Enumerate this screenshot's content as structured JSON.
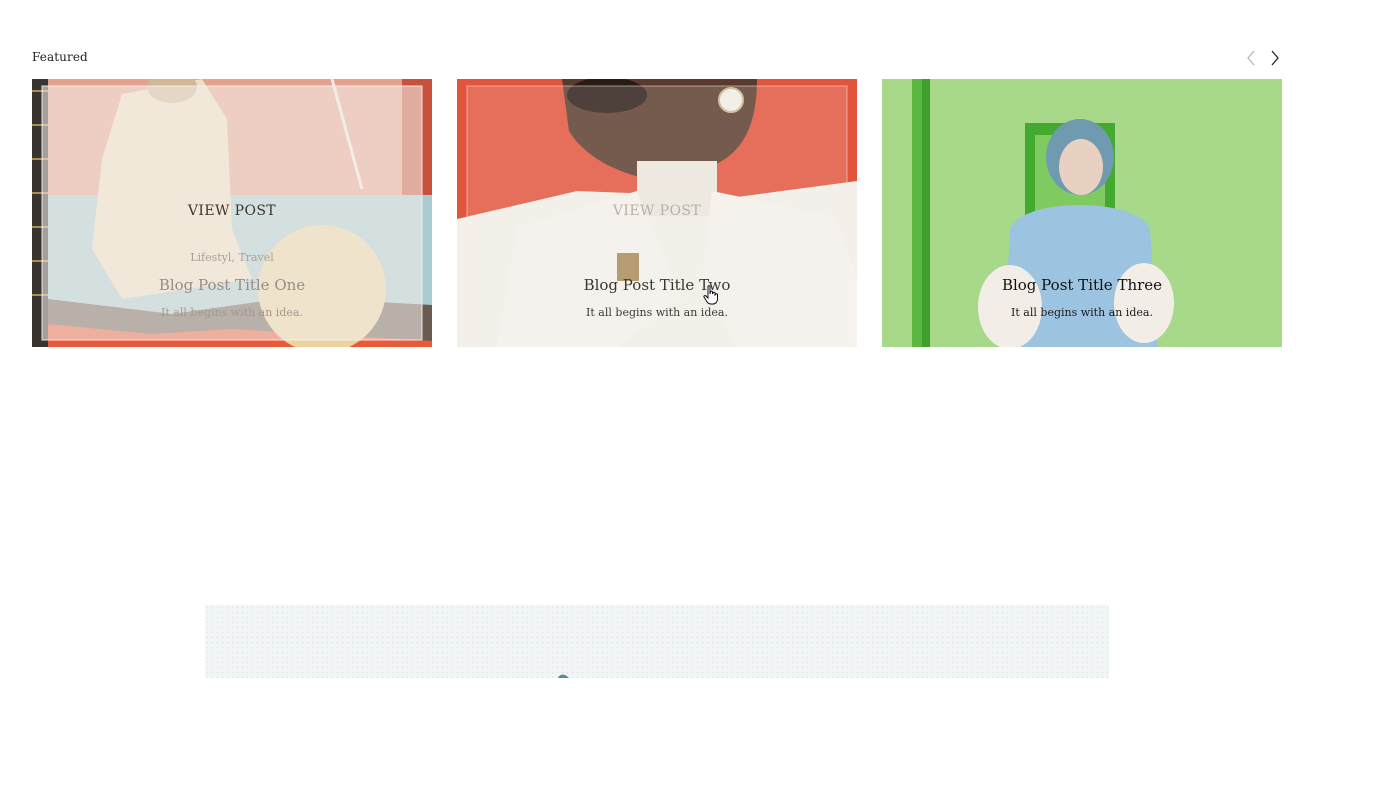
{
  "featured": {
    "section_title": "Featured",
    "prev_icon": "chevron-left-icon",
    "next_icon": "chevron-right-icon"
  },
  "cards": [
    {
      "view_label": "VIEW POST",
      "category": "Lifestyl, Travel",
      "title": "Blog Post Title One",
      "excerpt": "It all begins with an idea."
    },
    {
      "view_label": "VIEW POST",
      "title": "Blog Post Title Two",
      "excerpt": "It all begins with an idea."
    },
    {
      "title": "Blog Post Title Three",
      "excerpt": "It all begins with an idea."
    }
  ],
  "colors": {
    "card1_accent": "#c9503a",
    "card1_frame": "#e8a896",
    "card2_accent": "#e2543c",
    "card3_accent": "#6cc04a",
    "sweater": "#9cc3e0"
  }
}
